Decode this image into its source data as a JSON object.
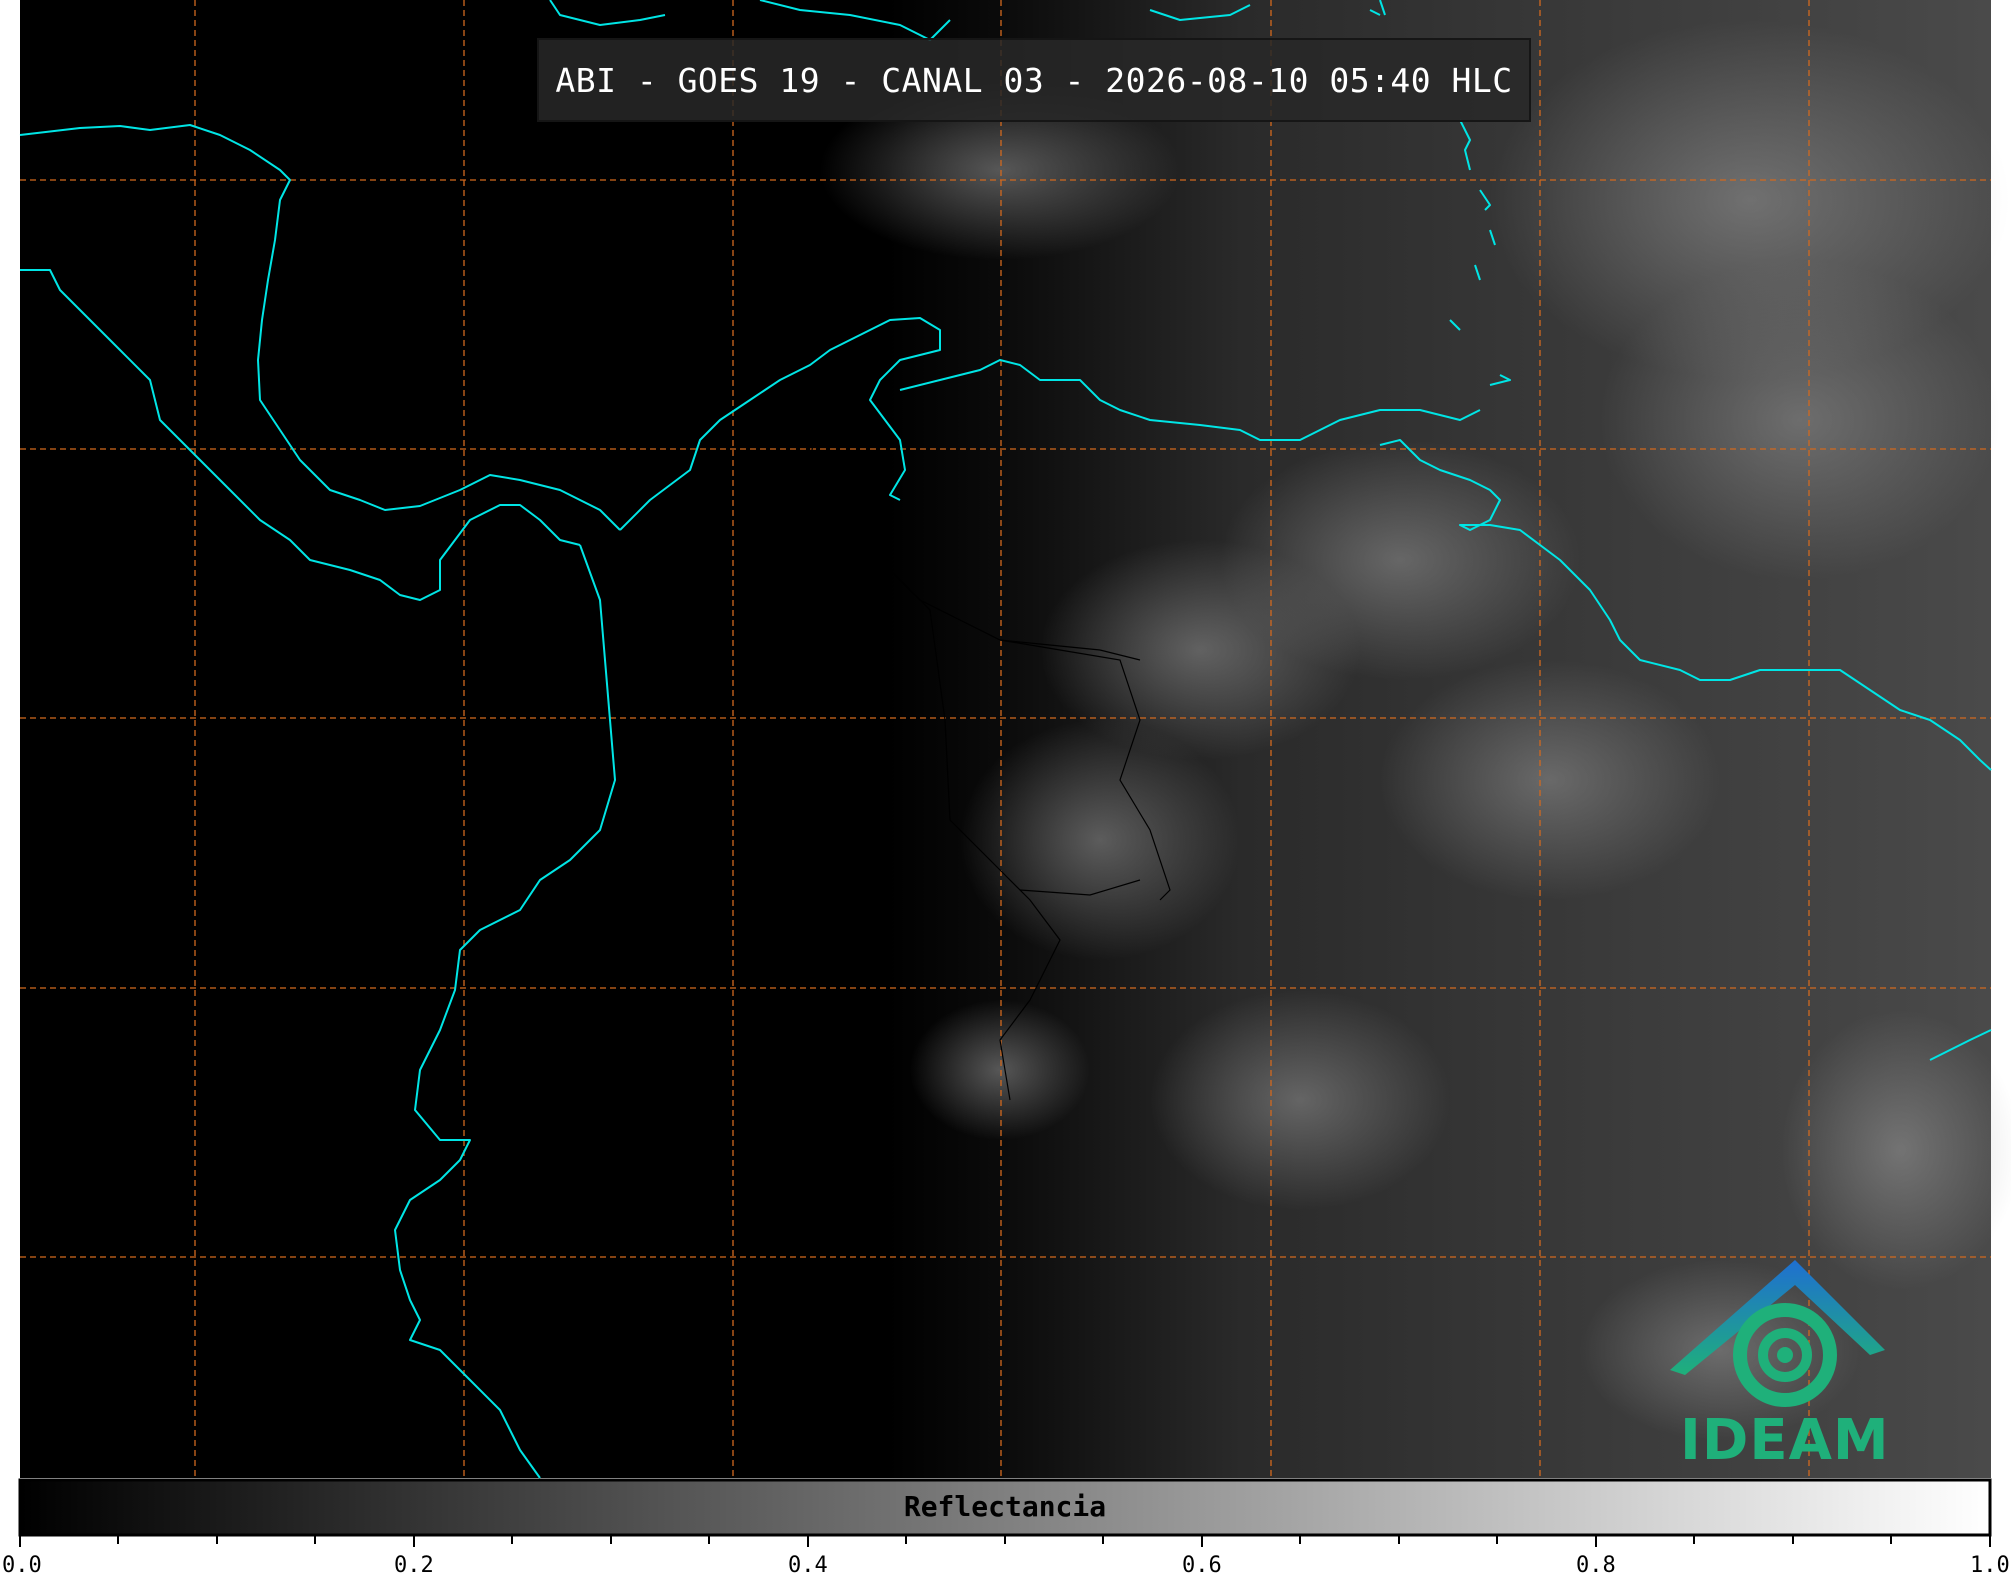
{
  "header": {
    "title": "ABI - GOES 19 - CANAL 03 - 2026-08-10 05:40 HLC"
  },
  "colorbar": {
    "label": "Reflectancia",
    "min": 0.0,
    "max": 1.0,
    "ticks": [
      "0.0",
      "0.2",
      "0.4",
      "0.6",
      "0.8",
      "1.0"
    ],
    "colormap": "grayscale"
  },
  "logo": {
    "text": "IDEAM",
    "color": "#1fb07a"
  },
  "colors": {
    "coastline": "#00e5e5",
    "gridline": "#d2691e",
    "borders": "#000000"
  }
}
